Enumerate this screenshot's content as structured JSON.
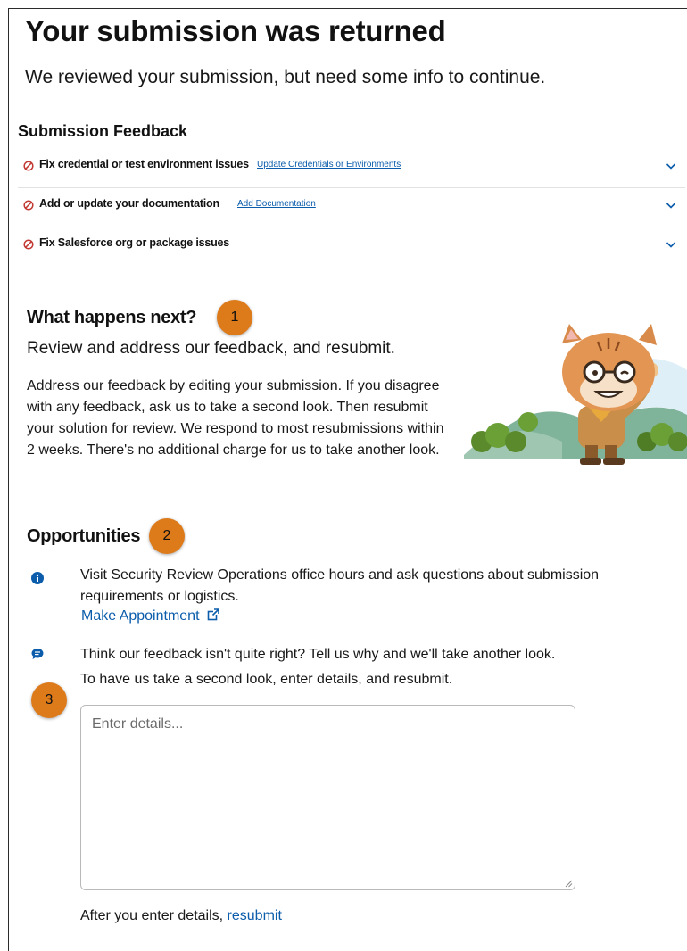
{
  "page": {
    "title": "Your submission was returned",
    "subtitle": "We reviewed your submission, but need some info to continue."
  },
  "feedback": {
    "heading": "Submission Feedback",
    "items": [
      {
        "label": "Fix credential or test environment issues",
        "link": "Update Credentials or Environments"
      },
      {
        "label": "Add or update your documentation",
        "link": "Add Documentation"
      },
      {
        "label": "Fix Salesforce org or package issues",
        "link": ""
      }
    ]
  },
  "next": {
    "heading": "What happens next?",
    "badge": "1",
    "subheading": "Review and address our feedback, and resubmit.",
    "body": "Address our feedback by editing your submission. If you disagree with any feedback, ask us to take a second look. Then resubmit your solution for review. We respond to most resubmissions within 2 weeks. There's no additional charge for us to take another look."
  },
  "opportunities": {
    "heading": "Opportunities",
    "badge": "2",
    "office_hours": {
      "text": "Visit Security Review Operations office hours and ask questions about submission requirements or logistics.",
      "link": "Make Appointment"
    },
    "second_look": {
      "line1": "Think our feedback isn't quite right? Tell us why and we'll take another look.",
      "line2": "To have us take a second look, enter details, and resubmit.",
      "badge": "3",
      "placeholder": "Enter details...",
      "after_prefix": "After you enter details,",
      "after_link": "resubmit"
    }
  },
  "colors": {
    "accent": "#0b5cab",
    "badge": "#dd7a1a",
    "error": "#c23934"
  }
}
